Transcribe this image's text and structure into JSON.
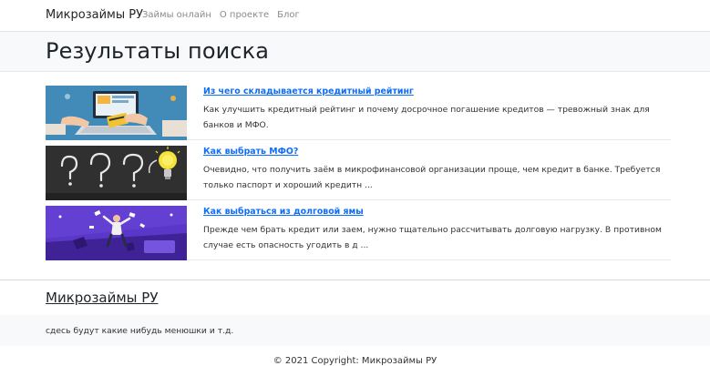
{
  "navbar": {
    "brand": "Микрозаймы РУ",
    "links": [
      "Займы онлайн",
      "О проекте",
      "Блог"
    ]
  },
  "page": {
    "title": "Результаты поиска"
  },
  "results": [
    {
      "title": "Из чего складывается кредитный рейтинг",
      "text": "Как улучшить кредитный рейтинг и почему досрочное погашение кредитов — тревожный знак для банков и МФО.",
      "image_icon": "laptop-credit-card-image"
    },
    {
      "title": "Как выбрать МФО?",
      "text": "Очевидно, что получить заём в микрофинансовой организации проще, чем кредит в банке. Требуется только паспорт и хороший кредитн ...",
      "image_icon": "lightbulb-question-image"
    },
    {
      "title": "Как выбраться из долговой ямы",
      "text": "Прежде чем брать кредит или заем, нужно тщательно рассчитывать долговую нагрузку. В противном случае есть опасность угодить в д ...",
      "image_icon": "falling-man-image"
    }
  ],
  "footer": {
    "brand": "Микрозаймы РУ",
    "menu_text": "сдесь будут какие нибудь менюшки и т.д.",
    "copyright": "© 2021 Copyright: Микрозаймы РУ"
  },
  "colors": {
    "link": "#0d6efd",
    "band": "#f8f9fa"
  }
}
